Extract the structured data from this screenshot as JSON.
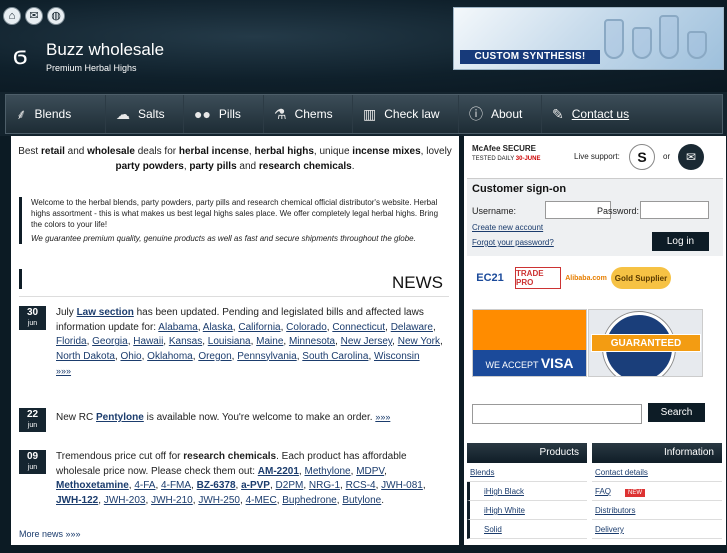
{
  "header": {
    "brand": "Buzz wholesale",
    "tagline": "Premium Herbal Highs",
    "banner_text": "CUSTOM SYNTHESIS!"
  },
  "toolbar": {
    "icons": [
      "home-icon",
      "mail-icon",
      "globe-icon"
    ]
  },
  "nav": [
    {
      "label": "Blends",
      "icon": "leaf-icon"
    },
    {
      "label": "Salts",
      "icon": "salt-icon"
    },
    {
      "label": "Pills",
      "icon": "pills-icon"
    },
    {
      "label": "Chems",
      "icon": "flask-icon"
    },
    {
      "label": "Check law",
      "icon": "book-icon"
    },
    {
      "label": "About",
      "icon": "info-icon"
    },
    {
      "label": "Contact us",
      "icon": "chat-icon"
    }
  ],
  "intro": {
    "p1": "Best ",
    "b1": "retail",
    "p2": " and ",
    "b2": "wholesale",
    "p3": " deals for ",
    "b3": "herbal incense",
    "p4": ", ",
    "b4": "herbal highs",
    "p5": ", unique ",
    "b5": "incense mixes",
    "p6": ", lovely ",
    "b6": "party powders",
    "p7": ", ",
    "b7": "party pills",
    "p8": " and ",
    "b8": "research chemicals",
    "p9": "."
  },
  "welcome": {
    "text": "Welcome to the herbal blends, party powders, party pills and research chemical official distributor's website. Herbal highs assortment - this is what makes us best legal highs sales place. We offer completely legal herbal highs. Bring the colors to your life!",
    "italic": "We guarantee premium quality, genuine products as well as fast and secure shipments throughout the globe."
  },
  "news": {
    "title": "NEWS",
    "items": [
      {
        "day": "30",
        "month": "jun"
      },
      {
        "day": "22",
        "month": "jun"
      },
      {
        "day": "09",
        "month": "jun"
      }
    ],
    "item1": {
      "a": "July ",
      "law": "Law section",
      "b": " has been updated. Pending and legislated bills and affected laws information update for: ",
      "states": [
        "Alabama",
        "Alaska",
        "California",
        "Colorado",
        "Connecticut",
        "Delaware",
        "Florida",
        "Georgia",
        "Hawaii",
        "Kansas",
        "Louisiana",
        "Maine",
        "Minnesota",
        "New Jersey",
        "New York",
        "North Dakota",
        "Ohio",
        "Oklahoma",
        "Oregon",
        "Pennsylvania",
        "South Carolina",
        "Wisconsin"
      ],
      "more": "»»»"
    },
    "item2": {
      "a": "New RC ",
      "product": "Pentylone",
      "b": " is available now. You're welcome to make an order.",
      "more": "»»»"
    },
    "item3": {
      "a": "Tremendous price cut off for ",
      "rc": "research chemicals",
      "b": ". Each product has affordable wholesale price now. Please check them out: ",
      "products": [
        "AM-2201",
        "Methylone",
        "MDPV",
        "Methoxetamine",
        "4-FA",
        "4-FMA",
        "BZ-6378",
        "a-PVP",
        "D2PM",
        "NRG-1",
        "RCS-4",
        "JWH-081",
        "JWH-122",
        "JWH-203",
        "JWH-210",
        "JWH-250",
        "4-MEC",
        "Buphedrone",
        "Butylone"
      ],
      "bold": [
        "AM-2201",
        "Methoxetamine",
        "BZ-6378",
        "a-PVP",
        "JWH-122"
      ]
    },
    "more_news": "More news »»»"
  },
  "sidebar": {
    "mcafee": {
      "title": "McAfee SECURE",
      "tested": "TESTED DAILY",
      "date": "30-JUNE"
    },
    "live_support": "Live support:",
    "or": "or",
    "signin": {
      "title": "Customer sign-on",
      "username": "Username:",
      "password": "Password:",
      "new_account": "Create new account",
      "forgot": "Forgot your password?",
      "login": "Log in"
    },
    "badges": [
      "EC21",
      "TRADE PRO",
      "Alibaba.com",
      "Gold Supplier"
    ],
    "visa": {
      "accept": "WE ACCEPT",
      "brand": "VISA"
    },
    "guaranteed": "GUARANTEED",
    "search": {
      "button": "Search",
      "placeholder": ""
    },
    "products": {
      "title": "Products",
      "items": [
        "Blends",
        "iHigh Black",
        "iHigh White",
        "Solid"
      ]
    },
    "information": {
      "title": "Information",
      "items": [
        "Contact details",
        "FAQ",
        "Distributors",
        "Delivery"
      ],
      "new_badge": "NEW"
    }
  },
  "colors": {
    "dark": "#0c1b24",
    "accent_orange": "#ff8c00",
    "visa_blue": "#1b4a9a",
    "link": "#1b3c6d"
  }
}
